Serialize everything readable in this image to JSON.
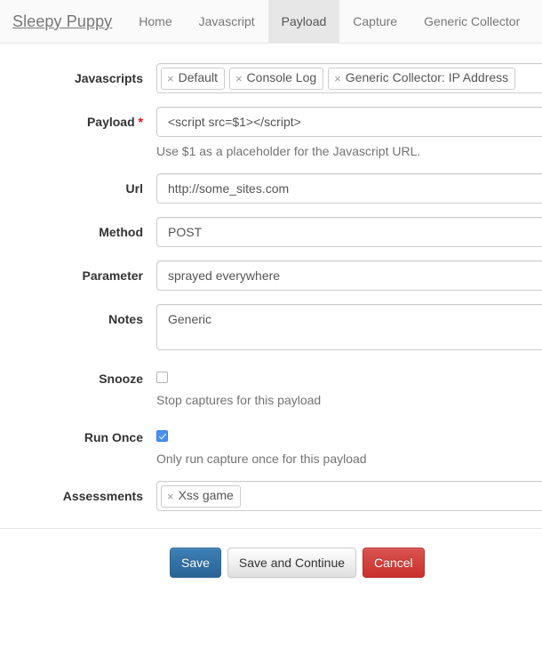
{
  "navbar": {
    "brand": "Sleepy Puppy",
    "items": [
      {
        "label": "Home",
        "active": false
      },
      {
        "label": "Javascript",
        "active": false
      },
      {
        "label": "Payload",
        "active": true
      },
      {
        "label": "Capture",
        "active": false
      },
      {
        "label": "Generic Collector",
        "active": false
      }
    ]
  },
  "form": {
    "javascripts": {
      "label": "Javascripts",
      "tokens": [
        "Default",
        "Console Log",
        "Generic Collector: IP Address"
      ],
      "remove_glyph": "×"
    },
    "payload": {
      "label": "Payload",
      "required_marker": "*",
      "value": "<script src=$1></script>",
      "help": "Use $1 as a placeholder for the Javascript URL."
    },
    "url": {
      "label": "Url",
      "value": "http://some_sites.com"
    },
    "method": {
      "label": "Method",
      "value": "POST"
    },
    "parameter": {
      "label": "Parameter",
      "value": "sprayed everywhere"
    },
    "notes": {
      "label": "Notes",
      "value": "Generic"
    },
    "snooze": {
      "label": "Snooze",
      "checked": false,
      "help": "Stop captures for this payload"
    },
    "run_once": {
      "label": "Run Once",
      "checked": true,
      "help": "Only run capture once for this payload"
    },
    "assessments": {
      "label": "Assessments",
      "tokens": [
        "Xss game"
      ],
      "remove_glyph": "×"
    }
  },
  "actions": {
    "save": "Save",
    "save_and_continue": "Save and Continue",
    "cancel": "Cancel"
  },
  "colors": {
    "primary": "#336699",
    "danger": "#d9534f",
    "required": "#ff0000",
    "nav_text": "#777777",
    "nav_active_bg": "#e7e7e7",
    "checkbox_checked": "#4a90f0"
  }
}
